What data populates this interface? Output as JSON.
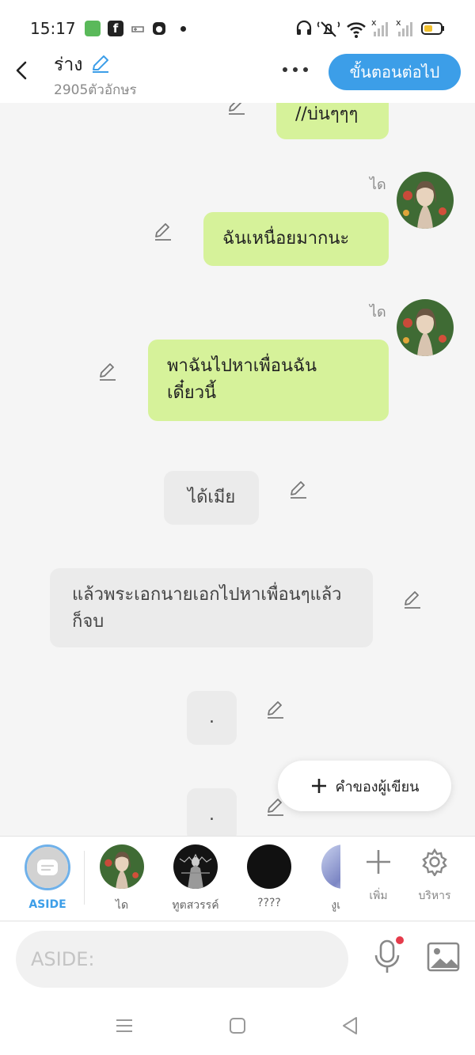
{
  "status_bar": {
    "time": "15:17",
    "icons_left": [
      "app-icon",
      "facebook-icon",
      "game-icon",
      "app-icon"
    ],
    "icons_right": [
      "headset-icon",
      "mute-icon",
      "wifi-icon",
      "signal-icon",
      "signal-icon",
      "battery-icon"
    ]
  },
  "header": {
    "title": "ร่าง",
    "char_count": "2905ตัวอักษร",
    "next_label": "ขั้นตอนต่อไป"
  },
  "messages": [
    {
      "type": "character",
      "text": "//บ่นๆๆๆ",
      "color": "#d6f29a"
    },
    {
      "type": "character",
      "speaker": "ได",
      "text": "ฉันเหนื่อยมากนะ",
      "color": "#d6f29a"
    },
    {
      "type": "character",
      "speaker": "ได",
      "text_line1": "พาฉันไปหาเพื่อนฉัน",
      "text_line2": "เดี๋ยวนี้",
      "color": "#d6f29a"
    },
    {
      "type": "aside",
      "text": "ได้เมีย",
      "color": "#ebebeb"
    },
    {
      "type": "aside",
      "text_line1": "แล้วพระเอกนายเอกไปหาเพื่อนๆแล้ว",
      "text_line2": "ก็จบ",
      "color": "#ebebeb"
    },
    {
      "type": "aside",
      "text": "."
    },
    {
      "type": "aside",
      "text": "."
    }
  ],
  "writer_button": {
    "label": "คำของผู้เขียน"
  },
  "characters": [
    {
      "name": "ASIDE",
      "selected": true
    },
    {
      "name": "ได"
    },
    {
      "name": "ทูตสวรรค์"
    },
    {
      "name": "????"
    },
    {
      "name": "งูเ"
    }
  ],
  "tools": {
    "add_label": "เพิ่ม",
    "manage_label": "บริหาร"
  },
  "input": {
    "placeholder": "ASIDE:"
  },
  "colors": {
    "accent": "#3c9ee8",
    "bubble_green": "#d6f29a",
    "bubble_grey": "#ebebeb"
  }
}
